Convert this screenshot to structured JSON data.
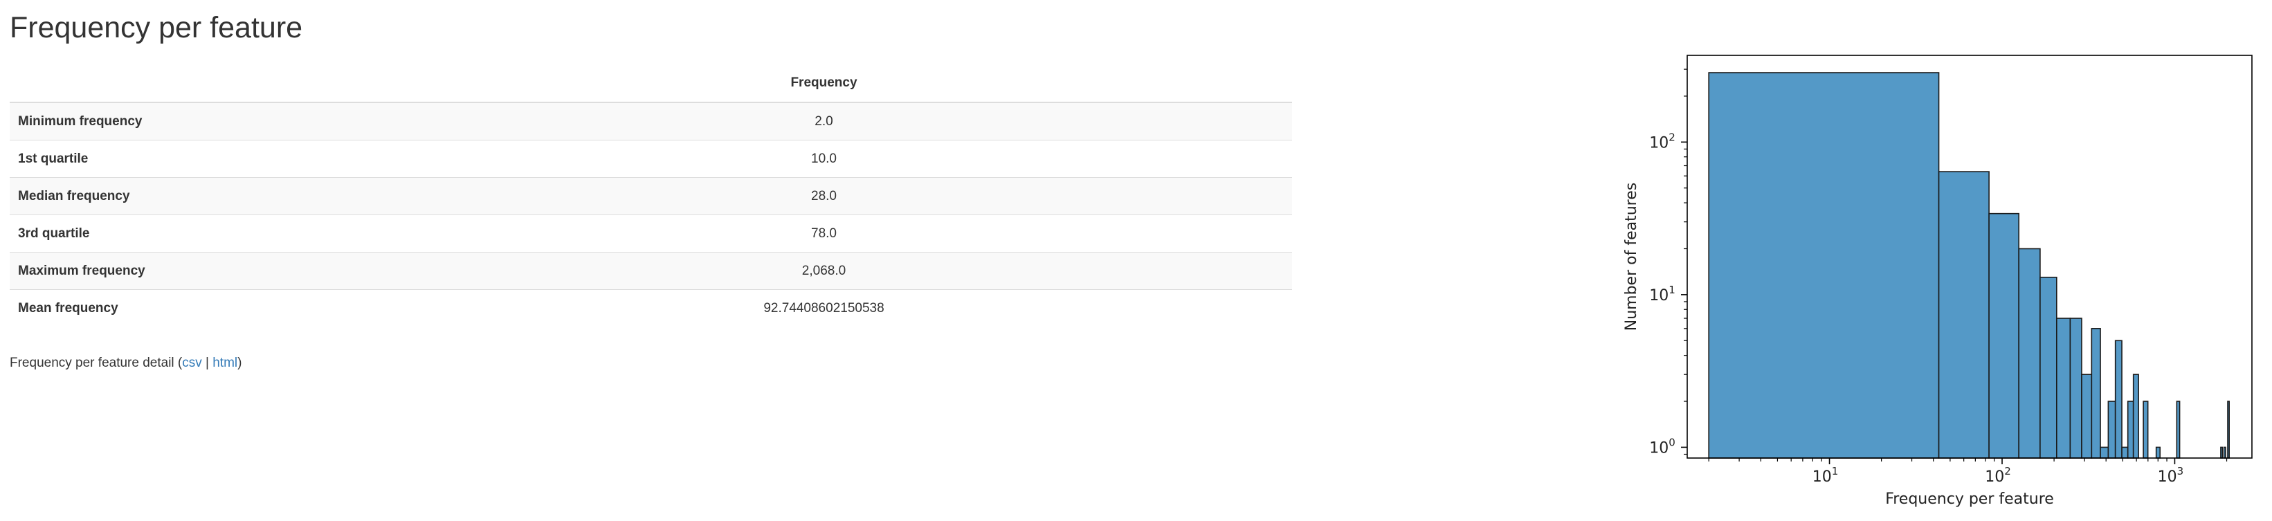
{
  "title": "Frequency per feature",
  "table": {
    "column_header": "Frequency",
    "rows": [
      {
        "label": "Minimum frequency",
        "value": "2.0"
      },
      {
        "label": "1st quartile",
        "value": "10.0"
      },
      {
        "label": "Median frequency",
        "value": "28.0"
      },
      {
        "label": "3rd quartile",
        "value": "78.0"
      },
      {
        "label": "Maximum frequency",
        "value": "2,068.0"
      },
      {
        "label": "Mean frequency",
        "value": "92.74408602150538"
      }
    ]
  },
  "detail": {
    "prefix": "Frequency per feature detail (",
    "csv_label": "csv",
    "separator": " | ",
    "html_label": "html",
    "suffix": ")"
  },
  "chart_data": {
    "type": "bar",
    "xlabel": "Frequency per feature",
    "ylabel": "Number of features",
    "xscale": "log",
    "yscale": "log",
    "xlim": [
      1.5,
      2800
    ],
    "ylim": [
      0.85,
      370
    ],
    "xticks": [
      {
        "base": "10",
        "exp": "1",
        "value": 10
      },
      {
        "base": "10",
        "exp": "2",
        "value": 100
      },
      {
        "base": "10",
        "exp": "3",
        "value": 1000
      }
    ],
    "yticks": [
      {
        "base": "10",
        "exp": "0",
        "value": 1
      },
      {
        "base": "10",
        "exp": "1",
        "value": 10
      },
      {
        "base": "10",
        "exp": "2",
        "value": 100
      }
    ],
    "bar_color": "#5499c7",
    "bins": [
      {
        "x0": 2.0,
        "x1": 43.0,
        "count": 285
      },
      {
        "x0": 43.0,
        "x1": 84.0,
        "count": 64
      },
      {
        "x0": 84.0,
        "x1": 125.0,
        "count": 34
      },
      {
        "x0": 125.0,
        "x1": 166.0,
        "count": 20
      },
      {
        "x0": 166.0,
        "x1": 207.0,
        "count": 13
      },
      {
        "x0": 207.0,
        "x1": 248.0,
        "count": 7
      },
      {
        "x0": 248.0,
        "x1": 289.0,
        "count": 7
      },
      {
        "x0": 289.0,
        "x1": 330.0,
        "count": 3
      },
      {
        "x0": 330.0,
        "x1": 371.0,
        "count": 6
      },
      {
        "x0": 371.0,
        "x1": 412.0,
        "count": 1
      },
      {
        "x0": 412.0,
        "x1": 453.0,
        "count": 2
      },
      {
        "x0": 453.0,
        "x1": 494.0,
        "count": 5
      },
      {
        "x0": 494.0,
        "x1": 535.0,
        "count": 1
      },
      {
        "x0": 535.0,
        "x1": 576.0,
        "count": 2
      },
      {
        "x0": 576.0,
        "x1": 617.0,
        "count": 3
      },
      {
        "x0": 658.0,
        "x1": 699.0,
        "count": 2
      },
      {
        "x0": 781.0,
        "x1": 822.0,
        "count": 1
      },
      {
        "x0": 1027.0,
        "x1": 1068.0,
        "count": 2
      },
      {
        "x0": 1847.0,
        "x1": 1888.0,
        "count": 1
      },
      {
        "x0": 1929.0,
        "x1": 1970.0,
        "count": 1
      },
      {
        "x0": 2027.0,
        "x1": 2068.0,
        "count": 2
      }
    ]
  }
}
